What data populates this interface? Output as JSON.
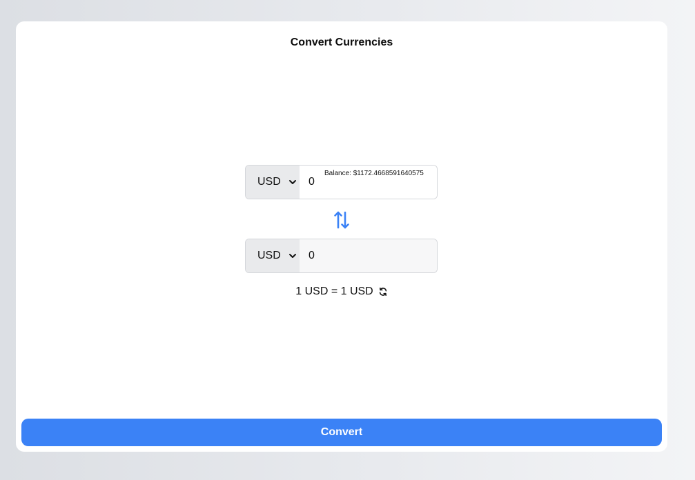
{
  "page": {
    "title": "Convert Currencies"
  },
  "from": {
    "currency": "USD",
    "amount": "0",
    "balance_text": "Balance: $1172.4668591640575"
  },
  "to": {
    "currency": "USD",
    "amount": "0"
  },
  "rate": {
    "text": "1 USD = 1 USD"
  },
  "actions": {
    "convert_label": "Convert"
  },
  "icons": {
    "currency_dropdown": "chevron-down-icon",
    "swap": "swap-vertical-icon",
    "refresh": "refresh-icon"
  },
  "colors": {
    "accent": "#3b82f6",
    "select_bg": "#e9eaec",
    "card_bg": "#ffffff"
  }
}
